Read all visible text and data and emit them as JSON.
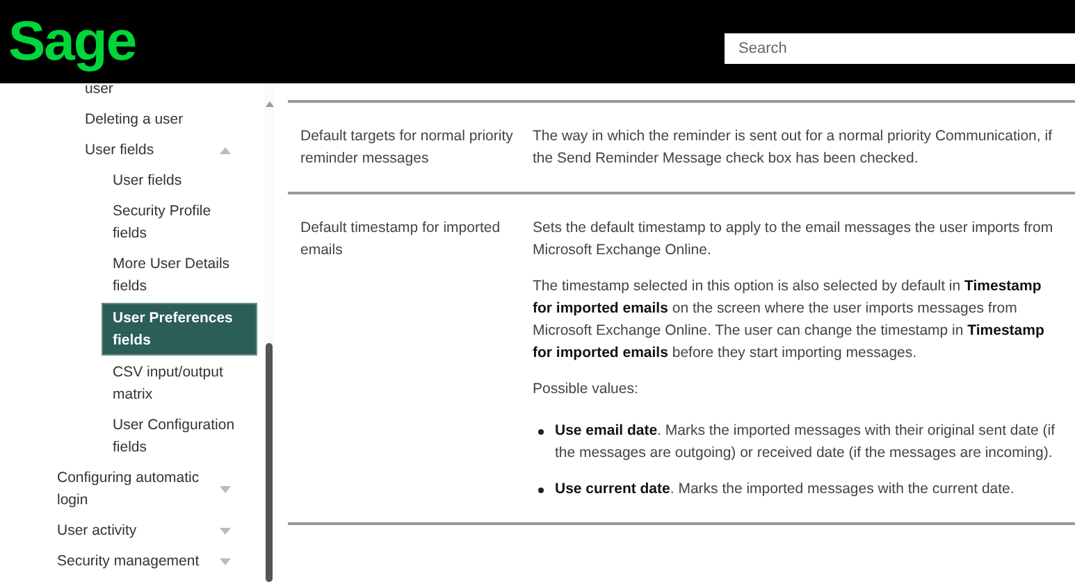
{
  "header": {
    "logo": "Sage",
    "search": {
      "placeholder": "Search"
    }
  },
  "sidebar": {
    "items": [
      {
        "children": [
          {
            "label": "user",
            "selected": false
          },
          {
            "label": "Deleting a user",
            "selected": false
          },
          {
            "label": "User fields",
            "selected": false,
            "expanded": true,
            "children": [
              {
                "label": "User fields",
                "selected": false
              },
              {
                "label": "Security Profile fields",
                "selected": false
              },
              {
                "label": "More User Details fields",
                "selected": false
              },
              {
                "label": "User Preferences fields",
                "selected": true
              },
              {
                "label": "CSV input/output matrix",
                "selected": false
              },
              {
                "label": "User Configuration fields",
                "selected": false
              }
            ]
          }
        ]
      },
      {
        "label": "Configuring automatic login",
        "selected": false,
        "expanded": false
      },
      {
        "label": "User activity",
        "selected": false,
        "expanded": false
      },
      {
        "label": "Security management",
        "selected": false,
        "expanded": false
      }
    ]
  },
  "table": {
    "rows": [
      {
        "term": "Default targets for normal priority reminder messages",
        "description": [
          {
            "kind": "text",
            "text": "The way in which the reminder is sent out for a normal priority Communication, if the Send Reminder Message check box has been checked."
          }
        ]
      },
      {
        "term": "Default timestamp for imported emails",
        "description": [
          {
            "kind": "text",
            "text": "Sets the default timestamp to apply to the email messages the user imports from Microsoft Exchange Online."
          },
          {
            "kind": "text",
            "text": "The timestamp selected in this option is also selected by default in **Timestamp for imported emails** on the screen where the user imports messages from Microsoft Exchange Online. The user can change the timestamp in **Timestamp for imported emails** before they start importing messages."
          },
          {
            "kind": "text",
            "text": "Possible values:"
          },
          {
            "kind": "list",
            "items": [
              "**Use email date**. Marks the imported messages with their original sent date (if the messages are outgoing) or received date (if the messages are incoming).",
              "**Use current date**. Marks the imported messages with the current date."
            ]
          }
        ]
      }
    ]
  }
}
